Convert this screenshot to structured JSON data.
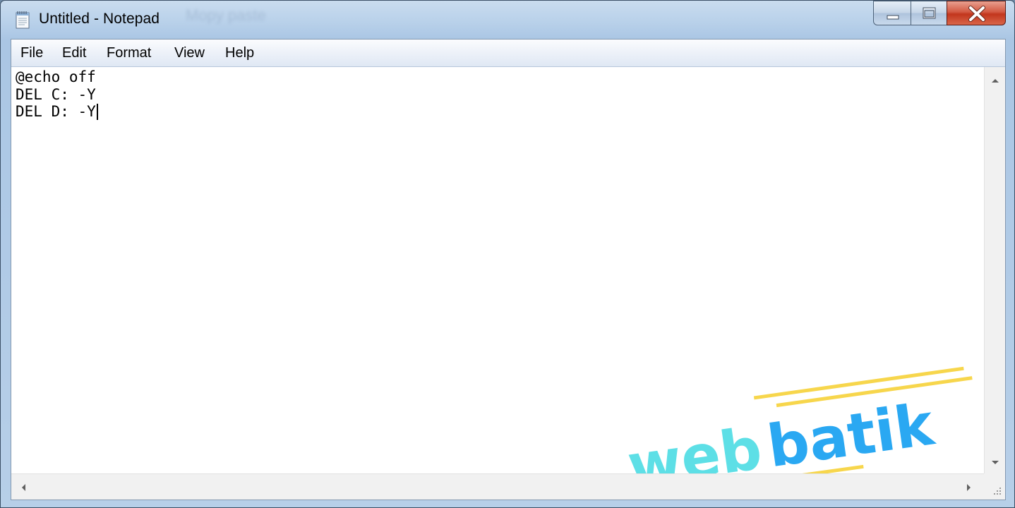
{
  "window": {
    "title": "Untitled - Notepad",
    "ghost_title": "Mopy paste"
  },
  "menu": {
    "items": [
      "File",
      "Edit",
      "Format",
      "View",
      "Help"
    ]
  },
  "editor": {
    "lines": [
      "@echo off",
      "DEL C: -Y",
      "DEL D: -Y"
    ]
  },
  "watermark": {
    "part1": "web",
    "part2": "batik",
    "color1": "#5ddfe6",
    "color2": "#2aa8f2",
    "line_color": "#f7d64c"
  },
  "colors": {
    "close_button": "#c8402a",
    "title_bar": "#b9d1ea"
  },
  "icons": [
    "notepad-icon",
    "minimize-icon",
    "maximize-icon",
    "close-icon",
    "scroll-up-icon",
    "scroll-down-icon",
    "scroll-left-icon",
    "scroll-right-icon",
    "resize-grip-icon"
  ]
}
